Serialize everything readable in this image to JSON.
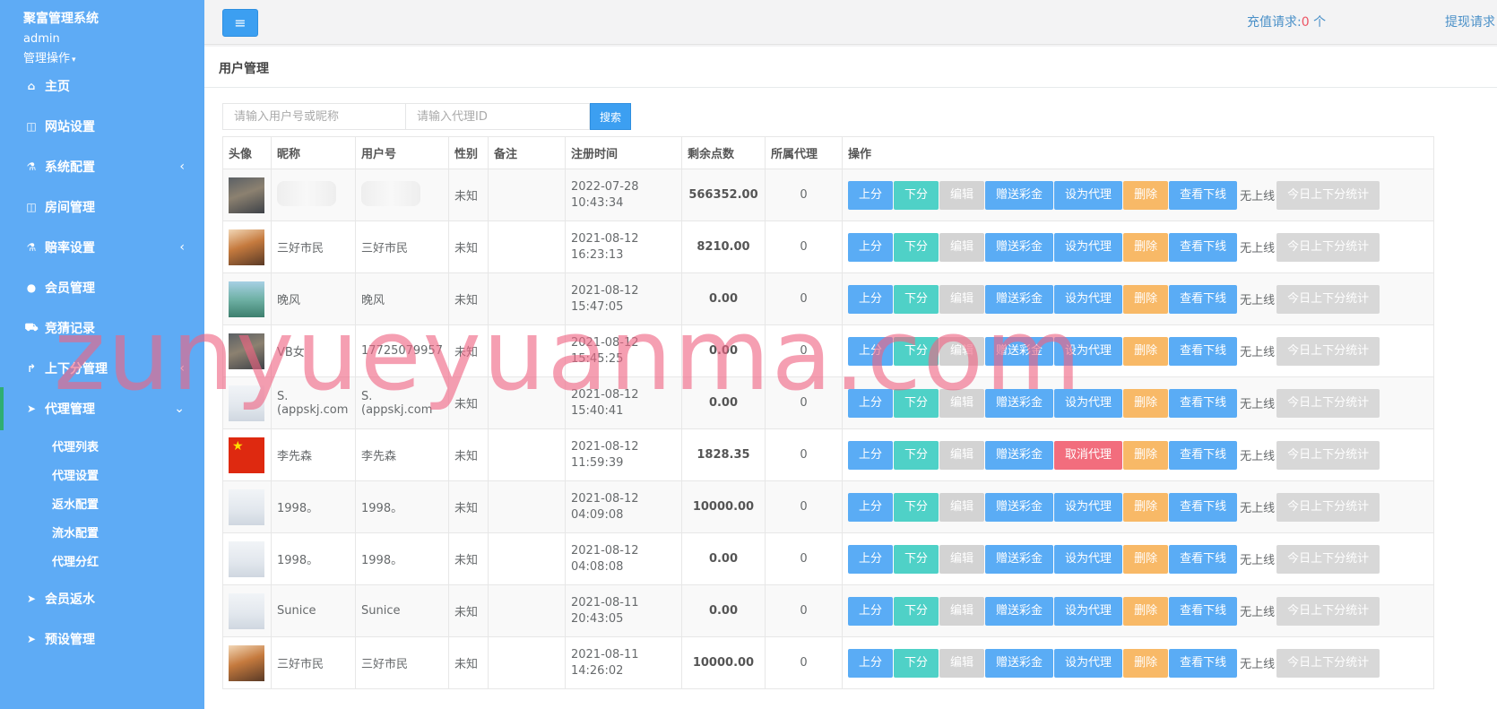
{
  "sidebar": {
    "brand": "聚富管理系统",
    "user": "admin",
    "user_menu": "管理操作",
    "items": [
      {
        "icon": "home-icon",
        "glyph": "⌂",
        "label": "主页"
      },
      {
        "icon": "columns-icon",
        "glyph": "◫",
        "label": "网站设置"
      },
      {
        "icon": "flask-icon",
        "glyph": "⚗",
        "label": "系统配置",
        "arrow": "‹"
      },
      {
        "icon": "columns-icon",
        "glyph": "◫",
        "label": "房间管理"
      },
      {
        "icon": "flask-icon",
        "glyph": "⚗",
        "label": "赔率设置",
        "arrow": "‹"
      },
      {
        "icon": "user-icon",
        "glyph": "●",
        "label": "会员管理"
      },
      {
        "icon": "car-icon",
        "glyph": "⛟",
        "label": "竞猜记录"
      },
      {
        "icon": "level-up-icon",
        "glyph": "↱",
        "label": "上下分管理",
        "arrow": "‹"
      },
      {
        "icon": "paper-plane-icon",
        "glyph": "➤",
        "label": "代理管理",
        "arrow": "⌄"
      },
      {
        "icon": "paper-plane-icon",
        "glyph": "➤",
        "label": "会员返水"
      },
      {
        "icon": "paper-plane-icon",
        "glyph": "➤",
        "label": "预设管理"
      }
    ],
    "sub_items": [
      "代理列表",
      "代理设置",
      "返水配置",
      "流水配置",
      "代理分红"
    ]
  },
  "topbar": {
    "menu_glyph": "≡",
    "recharge_label": "充值请求:",
    "recharge_count": "0",
    "recharge_unit": " 个",
    "withdraw_label": "提现请求"
  },
  "panel": {
    "title": "用户管理",
    "search_user_placeholder": "请输入用户号或昵称",
    "search_agent_placeholder": "请输入代理ID",
    "search_button": "搜索"
  },
  "table": {
    "headers": [
      "头像",
      "昵称",
      "用户号",
      "性别",
      "备注",
      "注册时间",
      "剩余点数",
      "所属代理",
      "操作"
    ],
    "buttons": {
      "up": "上分",
      "down": "下分",
      "edit": "编辑",
      "gift": "赠送彩金",
      "set_agent": "设为代理",
      "cancel_agent": "取消代理",
      "delete": "删除",
      "downline": "查看下线",
      "offline": "无上线",
      "stats": "今日上下分统计"
    },
    "rows": [
      {
        "avatar": "av-soldier",
        "nickname": "",
        "userid": "",
        "blurred": true,
        "gender": "未知",
        "remark": "",
        "date": "2022-07-28",
        "time": "10:43:34",
        "points": "566352.00",
        "agent": "0",
        "agent_btn": "set_agent"
      },
      {
        "avatar": "av-warrior",
        "nickname": "三好市民",
        "userid": "三好市民",
        "gender": "未知",
        "remark": "",
        "date": "2021-08-12",
        "time": "16:23:13",
        "points": "8210.00",
        "agent": "0",
        "agent_btn": "set_agent"
      },
      {
        "avatar": "av-lake",
        "nickname": "晚风",
        "userid": "晚风",
        "gender": "未知",
        "remark": "",
        "date": "2021-08-12",
        "time": "15:47:05",
        "points": "0.00",
        "agent": "0",
        "agent_btn": "set_agent"
      },
      {
        "avatar": "av-soldier",
        "nickname": "VB女",
        "userid": "17725079957",
        "gender": "未知",
        "remark": "",
        "date": "2021-08-12",
        "time": "15:45:25",
        "points": "0.00",
        "agent": "0",
        "agent_btn": "set_agent"
      },
      {
        "avatar": "av-placeholder",
        "nickname": "S.(appskj.com",
        "userid": "S.(appskj.com",
        "gender": "未知",
        "remark": "",
        "date": "2021-08-12",
        "time": "15:40:41",
        "points": "0.00",
        "agent": "0",
        "agent_btn": "set_agent"
      },
      {
        "avatar": "av-flag",
        "nickname": "李先森",
        "userid": "李先森",
        "gender": "未知",
        "remark": "",
        "date": "2021-08-12",
        "time": "11:59:39",
        "points": "1828.35",
        "agent": "0",
        "agent_btn": "cancel_agent"
      },
      {
        "avatar": "av-placeholder",
        "nickname": "1998。",
        "userid": "1998。",
        "gender": "未知",
        "remark": "",
        "date": "2021-08-12",
        "time": "04:09:08",
        "points": "10000.00",
        "agent": "0",
        "agent_btn": "set_agent"
      },
      {
        "avatar": "av-placeholder",
        "nickname": "1998。",
        "userid": "1998。",
        "gender": "未知",
        "remark": "",
        "date": "2021-08-12",
        "time": "04:08:08",
        "points": "0.00",
        "agent": "0",
        "agent_btn": "set_agent"
      },
      {
        "avatar": "av-placeholder",
        "nickname": "Sunice",
        "userid": "Sunice",
        "gender": "未知",
        "remark": "",
        "date": "2021-08-11",
        "time": "20:43:05",
        "points": "0.00",
        "agent": "0",
        "agent_btn": "set_agent"
      },
      {
        "avatar": "av-warrior",
        "nickname": "三好市民",
        "userid": "三好市民",
        "gender": "未知",
        "remark": "",
        "date": "2021-08-11",
        "time": "14:26:02",
        "points": "10000.00",
        "agent": "0",
        "agent_btn": "set_agent"
      }
    ]
  },
  "watermark": "zunyueyuanma.com"
}
